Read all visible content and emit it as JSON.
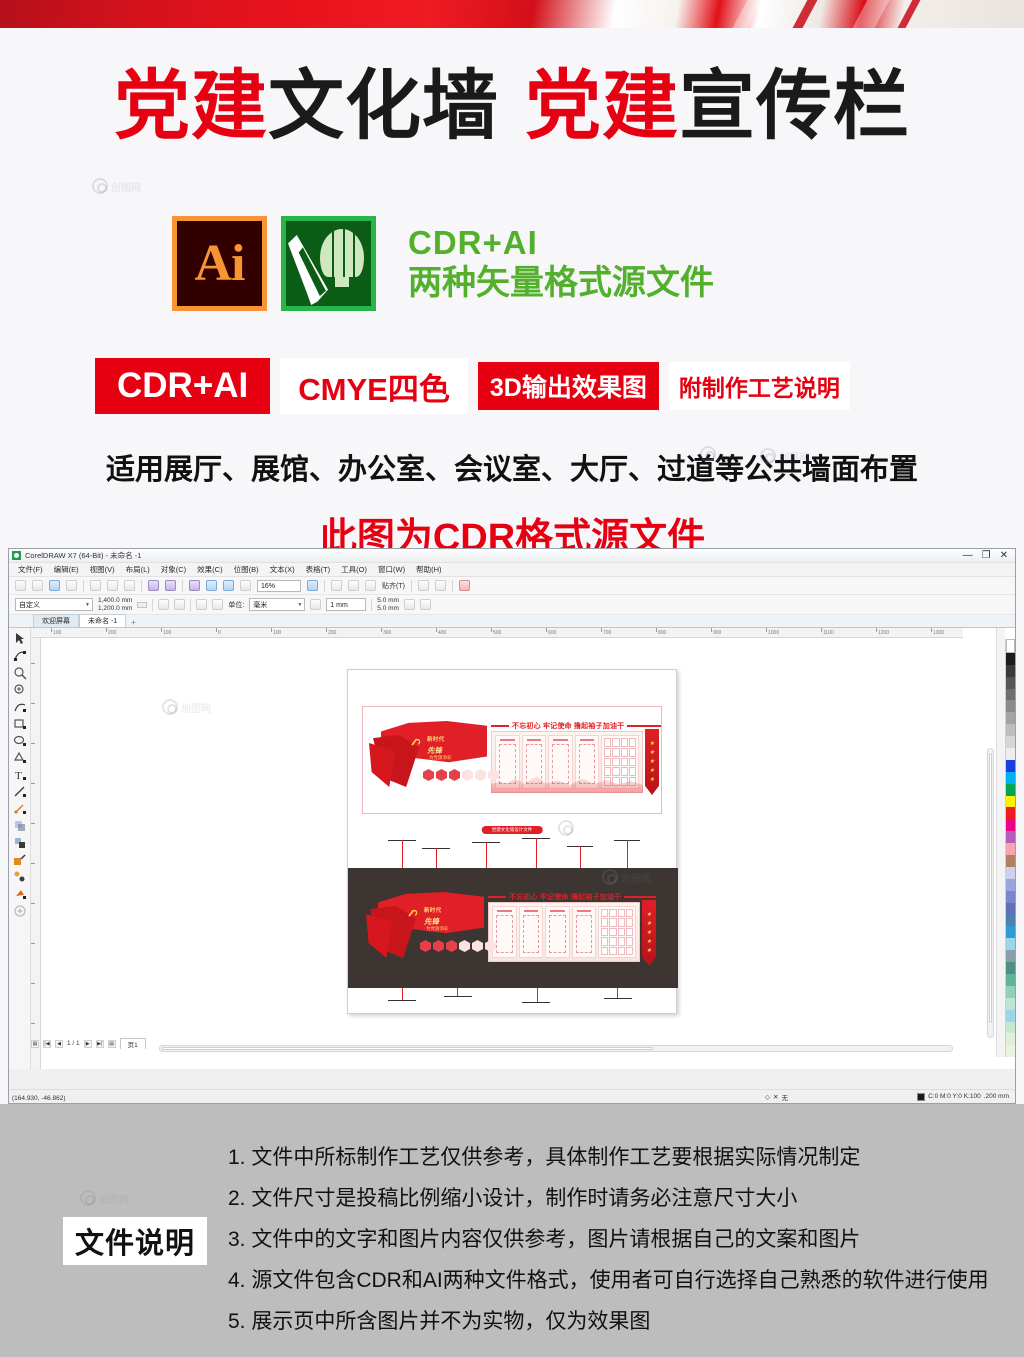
{
  "promo": {
    "title": {
      "seg1_red": "党建",
      "seg1_black": "文化墙",
      "seg2_red": "党建",
      "seg2_black": "宣传栏"
    },
    "ai_icon_label": "Ai",
    "formats_line1": "CDR+AI",
    "formats_line2": "两种矢量格式源文件",
    "badges": [
      {
        "label": "CDR+AI",
        "style": "filled"
      },
      {
        "label": "CMYE四色",
        "style": "outline"
      },
      {
        "label": "3D输出效果图",
        "style": "filled"
      },
      {
        "label": "附制作工艺说明",
        "style": "outline"
      }
    ],
    "apply_line": "适用展厅、展馆、办公室、会议室、大厅、过道等公共墙面布置",
    "format_line": "此图为CDR格式源文件",
    "colors": {
      "red": "#e60012",
      "green": "#53b02c",
      "ai_orange": "#f79433",
      "cdr_green": "#0b5d16"
    }
  },
  "coreldraw": {
    "title": "CorelDRAW X7 (64-Bit) - 未命名 -1",
    "window_controls": {
      "minimize": "—",
      "restore": "❐",
      "close": "✕"
    },
    "menus": [
      "文件(F)",
      "编辑(E)",
      "视图(V)",
      "布局(L)",
      "对象(C)",
      "效果(C)",
      "位图(B)",
      "文本(X)",
      "表格(T)",
      "工具(O)",
      "窗口(W)",
      "帮助(H)"
    ],
    "toolbar": {
      "zoom_level": "16%",
      "snap_label": "贴齐(T)"
    },
    "property_bar": {
      "page_preset": "自定义",
      "width": "1,400.0 mm",
      "height": "1,200.0 mm",
      "units_label": "单位:",
      "units_value": "毫米",
      "nudge": "1 mm",
      "duplicate_x": "5.0 mm",
      "duplicate_y": "5.0 mm"
    },
    "document_tabs": [
      {
        "label": "欢迎屏幕",
        "active": false
      },
      {
        "label": "未命名 -1",
        "active": true
      }
    ],
    "tab_add": "+",
    "ruler_ticks": [
      "100",
      "200",
      "100",
      "0",
      "100",
      "200",
      "300",
      "400",
      "500",
      "600",
      "700",
      "800",
      "900",
      "1000",
      "1100",
      "1200",
      "1300"
    ],
    "artwork": {
      "headline": "不忘初心 牢记使命 撸起袖子加油干",
      "flag_line1": "新时代",
      "flag_line2": "先锋",
      "flag_line3": "为党旗添彩",
      "page_label": "党建文化墙设计文件"
    },
    "page_nav": {
      "first": "|◀",
      "prev": "◀",
      "counter": "1 / 1",
      "next": "▶",
      "last": "▶|",
      "add": "▤",
      "page_tab": "页1"
    },
    "status": {
      "coords": "(164.930, -46.862)",
      "fill_none": "无",
      "outline_color": "C:0 M:0 Y:0 K:100",
      "outline_width": ".200 mm"
    }
  },
  "footer": {
    "label": "文件说明",
    "notes": [
      "1. 文件中所标制作工艺仅供参考，具体制作工艺要根据实际情况制定",
      "2. 文件尺寸是投稿比例缩小设计，制作时请务必注意尺寸大小",
      "3. 文件中的文字和图片内容仅供参考，图片请根据自己的文案和图片",
      "4. 源文件包含CDR和AI两种文件格式，使用者可自行选择自己熟悉的软件进行使用",
      "5. 展示页中所含图片并不为实物，仅为效果图"
    ]
  }
}
